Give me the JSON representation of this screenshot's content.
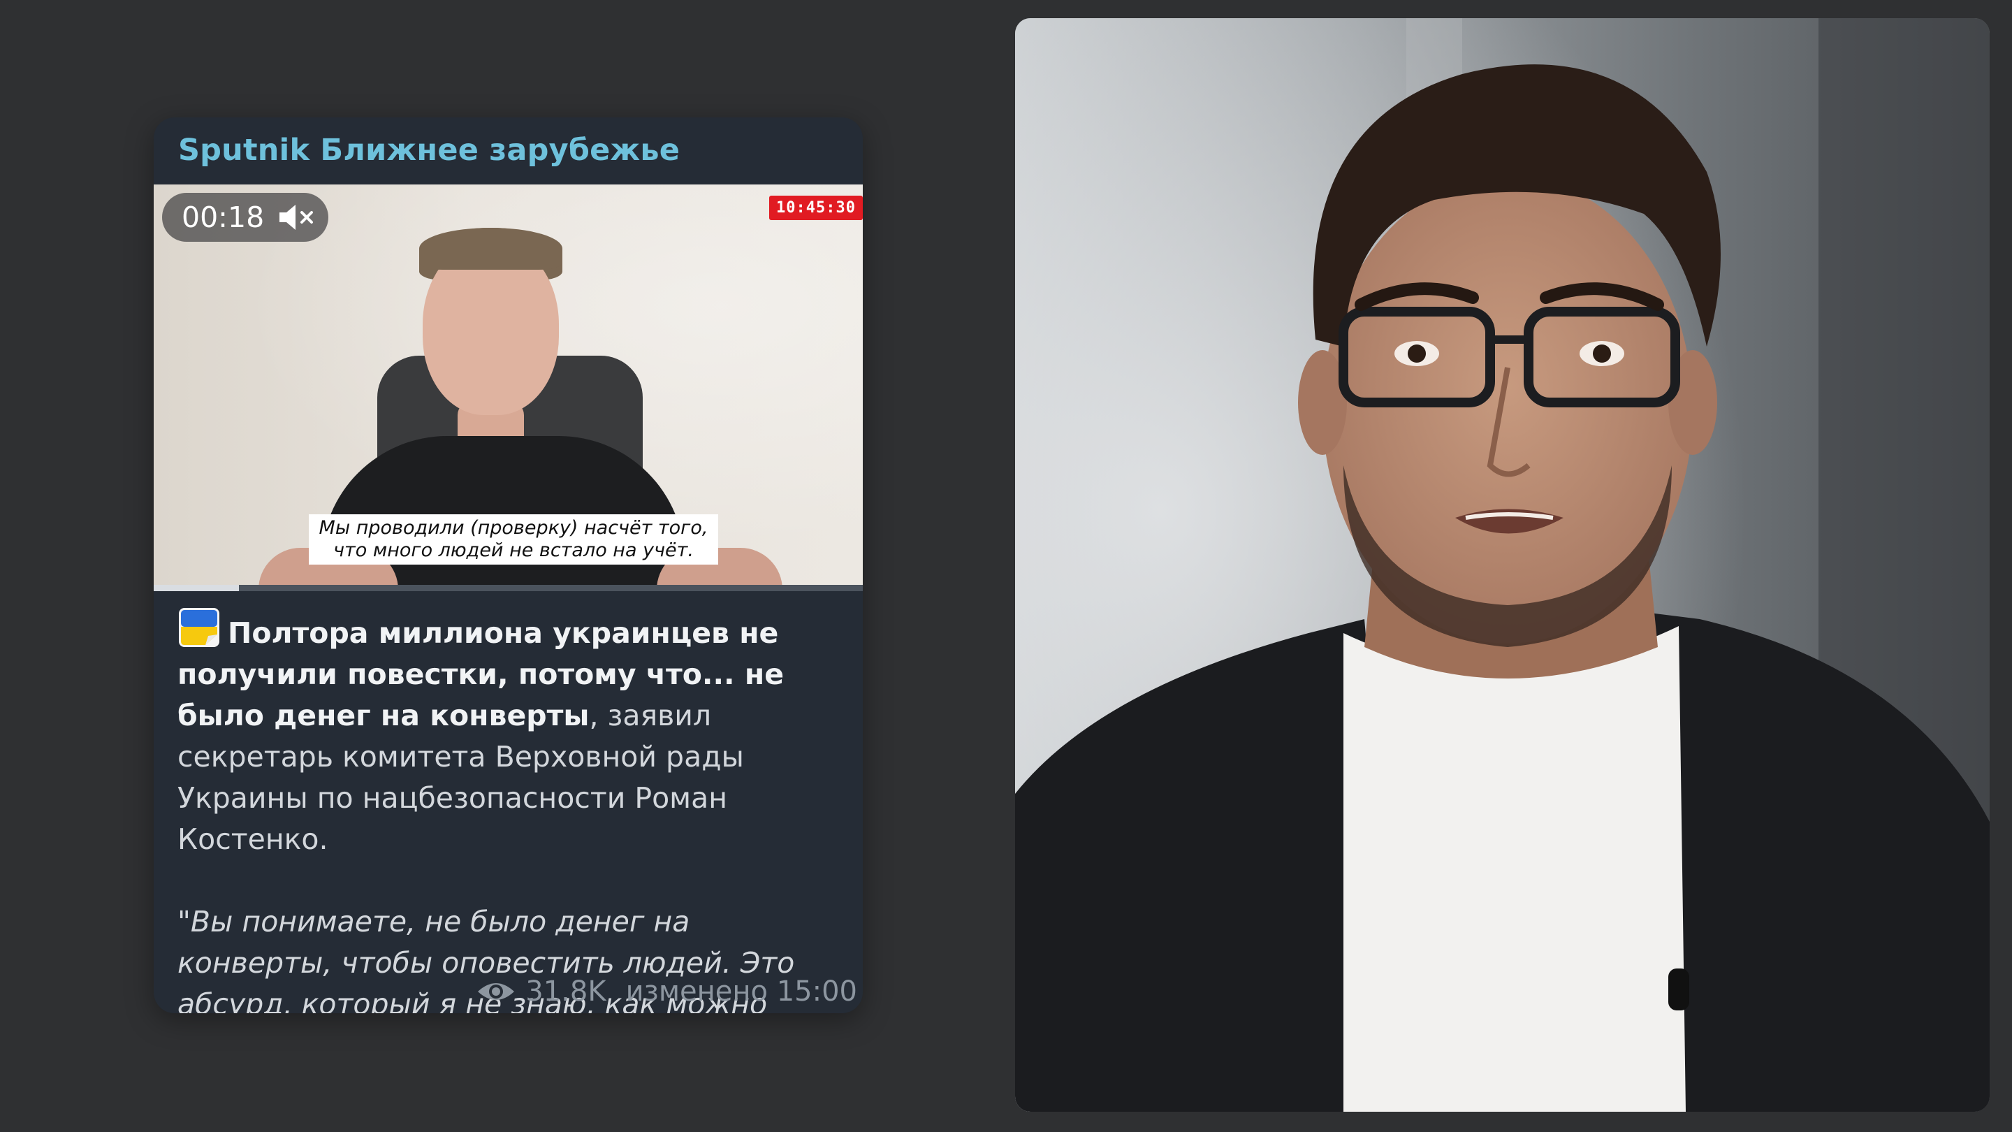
{
  "post": {
    "channel_name": "Sputnik Ближнее зарубежье",
    "video": {
      "timer": "00:18",
      "live_time": "10:45:30",
      "subtitle": "Мы проводили (проверку) насчёт того, что много людей не встало на учёт.",
      "progress": 0.12
    },
    "body": {
      "lead": "Полтора миллиона украинцев не получили повестки, потому что... не было денег на конверты",
      "rest": ", заявил секретарь комитета Верховной рады Украины по нацбезопасности Роман Костенко.",
      "quote": "\"Вы понимаете, не было денег на конверты, чтобы оповестить людей. Это абсурд, который я не знаю, как можно объяснить\"."
    },
    "meta": {
      "views": "31.8K",
      "edited": "изменено 15:00"
    }
  },
  "colors": {
    "background": "#2f3032",
    "card": "#252c36",
    "channel_accent": "#6ec1dc",
    "live_red": "#e11b22"
  },
  "icons": {
    "mute": "speaker-muted-icon",
    "views": "eye-icon",
    "flag": "ukraine-flag-icon"
  }
}
